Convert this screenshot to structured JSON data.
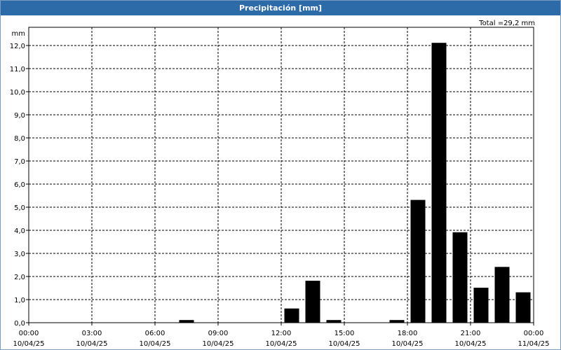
{
  "window": {
    "title": "Precipitación [mm]"
  },
  "chart_data": {
    "type": "bar",
    "title": "Precipitación [mm]",
    "ylabel": "mm",
    "total_label": "Total =29,2 mm",
    "ylim": [
      0,
      12.0
    ],
    "yticks": [
      "0,0",
      "1,0",
      "2,0",
      "3,0",
      "4,0",
      "5,0",
      "6,0",
      "7,0",
      "8,0",
      "9,0",
      "10,0",
      "11,0",
      "12,0"
    ],
    "xticks": [
      {
        "time": "00:00",
        "date": "10/04/25"
      },
      {
        "time": "03:00",
        "date": "10/04/25"
      },
      {
        "time": "06:00",
        "date": "10/04/25"
      },
      {
        "time": "09:00",
        "date": "10/04/25"
      },
      {
        "time": "12:00",
        "date": "10/04/25"
      },
      {
        "time": "15:00",
        "date": "10/04/25"
      },
      {
        "time": "18:00",
        "date": "10/04/25"
      },
      {
        "time": "21:00",
        "date": "10/04/25"
      },
      {
        "time": "00:00",
        "date": "11/04/25"
      }
    ],
    "grid": true,
    "bar_color": "#000000",
    "bars": [
      {
        "hour": "07:00",
        "value": 0.1
      },
      {
        "hour": "12:00",
        "value": 0.6
      },
      {
        "hour": "13:00",
        "value": 1.8
      },
      {
        "hour": "14:00",
        "value": 0.1
      },
      {
        "hour": "17:00",
        "value": 0.1
      },
      {
        "hour": "18:00",
        "value": 5.3
      },
      {
        "hour": "19:00",
        "value": 12.1
      },
      {
        "hour": "20:00",
        "value": 3.9
      },
      {
        "hour": "21:00",
        "value": 1.5
      },
      {
        "hour": "22:00",
        "value": 2.4
      },
      {
        "hour": "23:00",
        "value": 1.3
      }
    ]
  }
}
